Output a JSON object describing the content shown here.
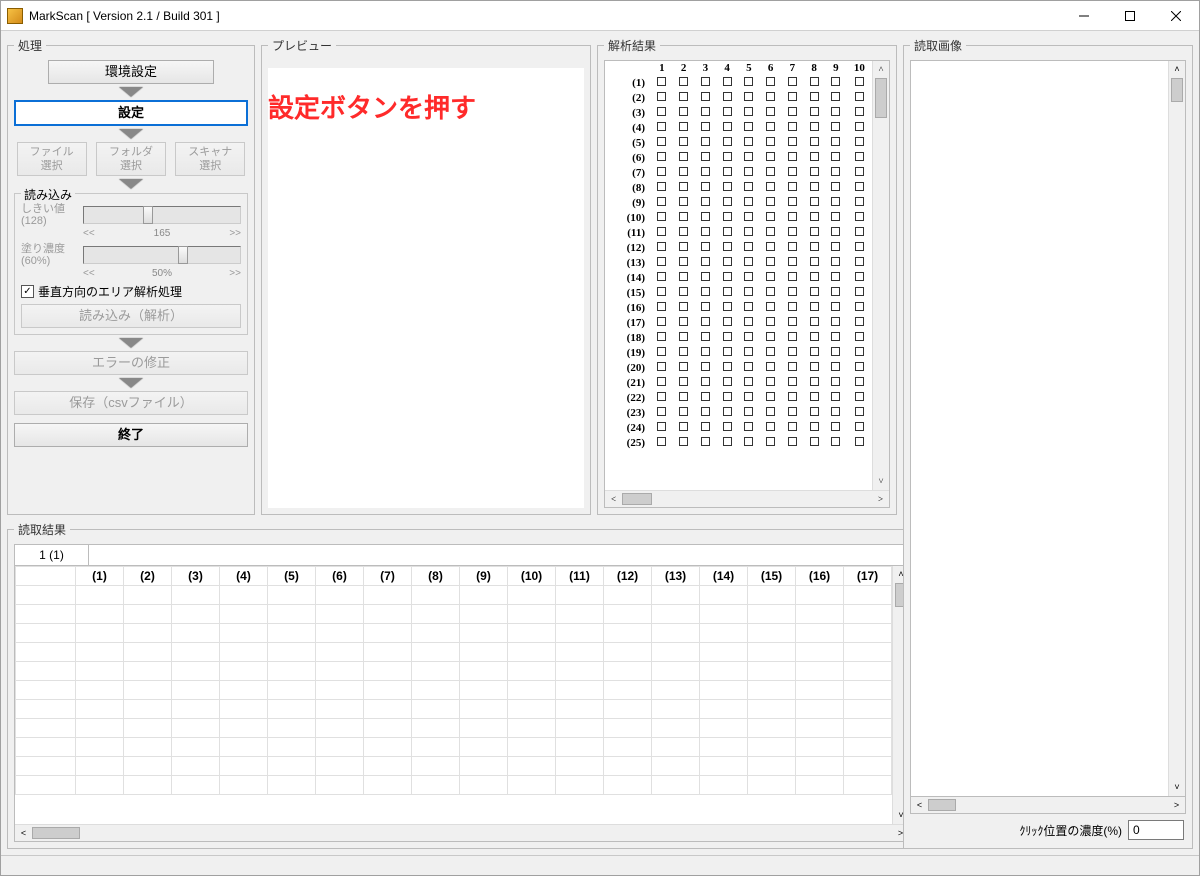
{
  "window": {
    "title": "MarkScan [ Version 2.1 / Build 301 ]"
  },
  "annotation_text": "設定ボタンを押す",
  "panels": {
    "process": "処理",
    "preview": "プレビュー",
    "analysis": "解析結果",
    "read_results": "読取結果",
    "read_image": "読取画像"
  },
  "process": {
    "env_button": "環境設定",
    "setting_button": "設定",
    "file_select": "ファイル\n選択",
    "folder_select": "フォルダ\n選択",
    "scanner_select": "スキャナ\n選択",
    "read_group": "読み込み",
    "threshold_label": "しきい値\n(128)",
    "threshold_display": "165",
    "density_label": "塗り濃度\n(60%)",
    "density_display": "50%",
    "checkbox_label": "垂直方向のエリア解析処理",
    "checkbox_checked": true,
    "read_analyze_button": "読み込み（解析）",
    "error_fix_button": "エラーの修正",
    "save_button": "保存（csvファイル）",
    "exit_button": "終了",
    "slider_left": "<<",
    "slider_right": ">>"
  },
  "analysis": {
    "col_headers": [
      "1",
      "2",
      "3",
      "4",
      "5",
      "6",
      "7",
      "8",
      "9",
      "10"
    ],
    "rows": 25
  },
  "read_results": {
    "top_cell": "1 (1)",
    "col_headers": [
      "(1)",
      "(2)",
      "(3)",
      "(4)",
      "(5)",
      "(6)",
      "(7)",
      "(8)",
      "(9)",
      "(10)",
      "(11)",
      "(12)",
      "(13)",
      "(14)",
      "(15)",
      "(16)",
      "(17)"
    ],
    "visible_rows": 11
  },
  "right": {
    "density_label": "ｸﾘｯｸ位置の濃度(%)",
    "density_value": "0"
  }
}
